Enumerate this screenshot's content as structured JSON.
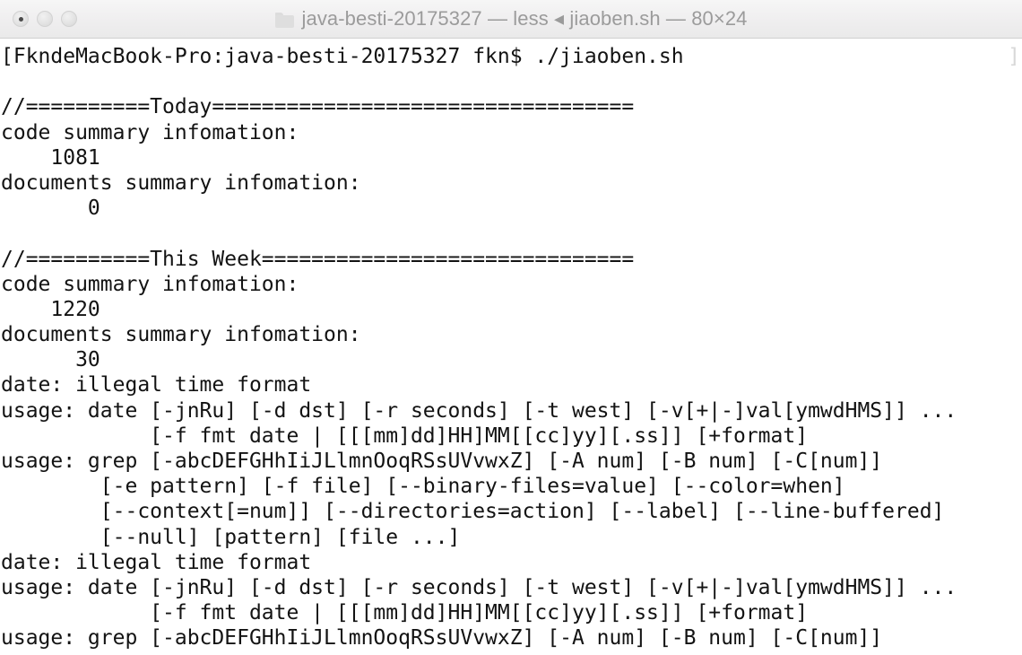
{
  "window": {
    "title": "java-besti-20175327 — less ◂ jiaoben.sh — 80×24",
    "folder_icon": "folder-icon",
    "traffic_lights": [
      {
        "name": "close-button",
        "label": "close"
      },
      {
        "name": "minimize-button",
        "label": "minimize"
      },
      {
        "name": "zoom-button",
        "label": "zoom"
      }
    ],
    "size_spec": "80×24",
    "colors": {
      "titlebar_bg": "#efeeef",
      "titlebar_text": "#9b9b9b",
      "terminal_bg": "#ffffff",
      "terminal_text": "#131313"
    }
  },
  "terminal": {
    "prompt_line": "[FkndeMacBook-Pro:java-besti-20175327 fkn$ ./jiaoben.sh",
    "right_artifact": "]",
    "lines": [
      "[FkndeMacBook-Pro:java-besti-20175327 fkn$ ./jiaoben.sh",
      "",
      "//==========Today==================================",
      "code summary infomation:",
      "    1081",
      "documents summary infomation:",
      "       0",
      "",
      "//==========This Week==============================",
      "code summary infomation:",
      "    1220",
      "documents summary infomation:",
      "      30",
      "date: illegal time format",
      "usage: date [-jnRu] [-d dst] [-r seconds] [-t west] [-v[+|-]val[ymwdHMS]] ...",
      "            [-f fmt date | [[[mm]dd]HH]MM[[cc]yy][.ss]] [+format]",
      "usage: grep [-abcDEFGHhIiJLlmnOoqRSsUVvwxZ] [-A num] [-B num] [-C[num]]",
      "        [-e pattern] [-f file] [--binary-files=value] [--color=when]",
      "        [--context[=num]] [--directories=action] [--label] [--line-buffered]",
      "        [--null] [pattern] [file ...]",
      "date: illegal time format",
      "usage: date [-jnRu] [-d dst] [-r seconds] [-t west] [-v[+|-]val[ymwdHMS]] ...",
      "            [-f fmt date | [[[mm]dd]HH]MM[[cc]yy][.ss]] [+format]",
      "usage: grep [-abcDEFGHhIiJLlmnOoqRSsUVvwxZ] [-A num] [-B num] [-C[num]]"
    ],
    "sections": {
      "today": {
        "header": "//==========Today==================================",
        "code_label": "code summary infomation:",
        "code_value": "1081",
        "documents_label": "documents summary infomation:",
        "documents_value": "0"
      },
      "this_week": {
        "header": "//==========This Week==============================",
        "code_label": "code summary infomation:",
        "code_value": "1220",
        "documents_label": "documents summary infomation:",
        "documents_value": "30"
      }
    },
    "errors": [
      "date: illegal time format",
      "usage: date [-jnRu] [-d dst] [-r seconds] [-t west] [-v[+|-]val[ymwdHMS]] ...",
      "usage: grep [-abcDEFGHhIiJLlmnOoqRSsUVvwxZ] [-A num] [-B num] [-C[num]]"
    ]
  }
}
